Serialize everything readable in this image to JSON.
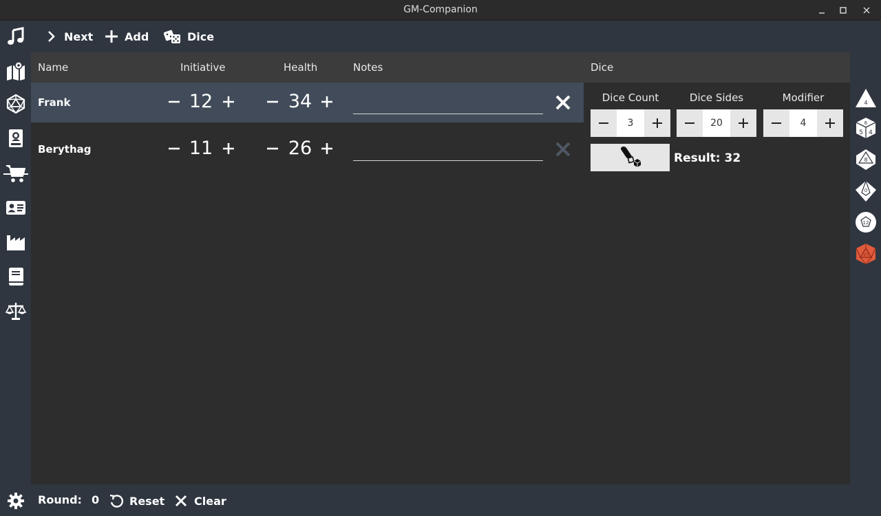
{
  "window": {
    "title": "GM-Companion"
  },
  "toolbar": {
    "next_label": "Next",
    "add_label": "Add",
    "dice_label": "Dice"
  },
  "sidebar": {
    "items": [
      {
        "icon": "music-icon"
      },
      {
        "icon": "map-icon"
      },
      {
        "icon": "d20-icon"
      },
      {
        "icon": "combat-tracker-icon",
        "active": true
      },
      {
        "icon": "shopping-cart-icon"
      },
      {
        "icon": "id-card-icon"
      },
      {
        "icon": "factory-icon"
      },
      {
        "icon": "book-icon"
      },
      {
        "icon": "balance-scale-icon"
      }
    ]
  },
  "table": {
    "headers": {
      "name": "Name",
      "initiative": "Initiative",
      "health": "Health",
      "notes": "Notes"
    },
    "rows": [
      {
        "name": "Frank",
        "initiative": "12",
        "health": "34",
        "notes": ""
      },
      {
        "name": "Berythag",
        "initiative": "11",
        "health": "26",
        "notes": ""
      }
    ]
  },
  "dice": {
    "title": "Dice",
    "count_label": "Dice Count",
    "sides_label": "Dice Sides",
    "modifier_label": "Modifier",
    "count": "3",
    "sides": "20",
    "modifier": "4",
    "result": "Result: 32",
    "dice_types": [
      "d4-icon",
      "d6-icon",
      "d8-icon",
      "d10-icon",
      "d12-icon",
      "d20-icon"
    ],
    "selected": "d20-icon",
    "accent_color": "#e05a3c"
  },
  "footer": {
    "round_label": "Round:",
    "round_value": "0",
    "reset_label": "Reset",
    "clear_label": "Clear"
  }
}
